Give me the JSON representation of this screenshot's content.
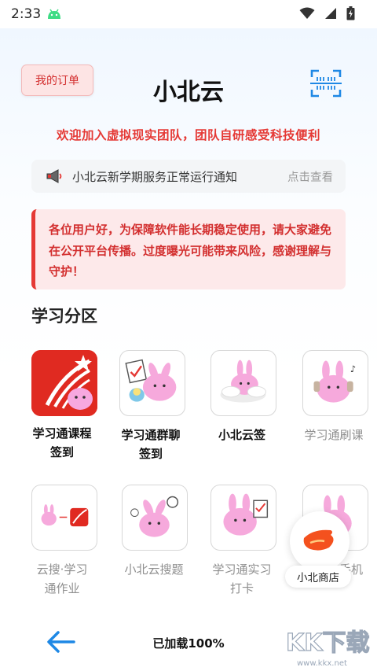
{
  "status_bar": {
    "time": "2:33"
  },
  "header": {
    "order_button": "我的订单",
    "title": "小北云",
    "slogan": "欢迎加入虚拟现实团队，团队自研感受科技便利"
  },
  "notice": {
    "text": "小北云新学期服务正常运行通知",
    "link": "点击查看"
  },
  "warning": {
    "text": "各位用户好，为保障软件能长期稳定使用，请大家避免在公开平台传播。过度曝光可能带来风险，感谢理解与守护！"
  },
  "section": {
    "title": "学习分区"
  },
  "grid": {
    "items": [
      {
        "label_line1": "学习通课程",
        "label_line2": "签到"
      },
      {
        "label_line1": "学习通群聊",
        "label_line2": "签到"
      },
      {
        "label_line1": "小北云签",
        "label_line2": ""
      },
      {
        "label_line1": "学习通刷课",
        "label_line2": ""
      },
      {
        "label_line1": "云搜·学习",
        "label_line2": "通作业"
      },
      {
        "label_line1": "小北云搜题",
        "label_line2": ""
      },
      {
        "label_line1": "学习通实习",
        "label_line2": "打卡"
      },
      {
        "label_line1": "手机",
        "label_line2": ""
      }
    ]
  },
  "floating_shop": {
    "label": "小北商店"
  },
  "bottom_bar": {
    "status": "已加载100%"
  },
  "watermark": {
    "brand": "KK下载",
    "url": "www.kkx.net"
  },
  "colors": {
    "accent_red": "#e53935",
    "scan_blue": "#1e88e5",
    "bunny_pink": "#f49ad8"
  }
}
